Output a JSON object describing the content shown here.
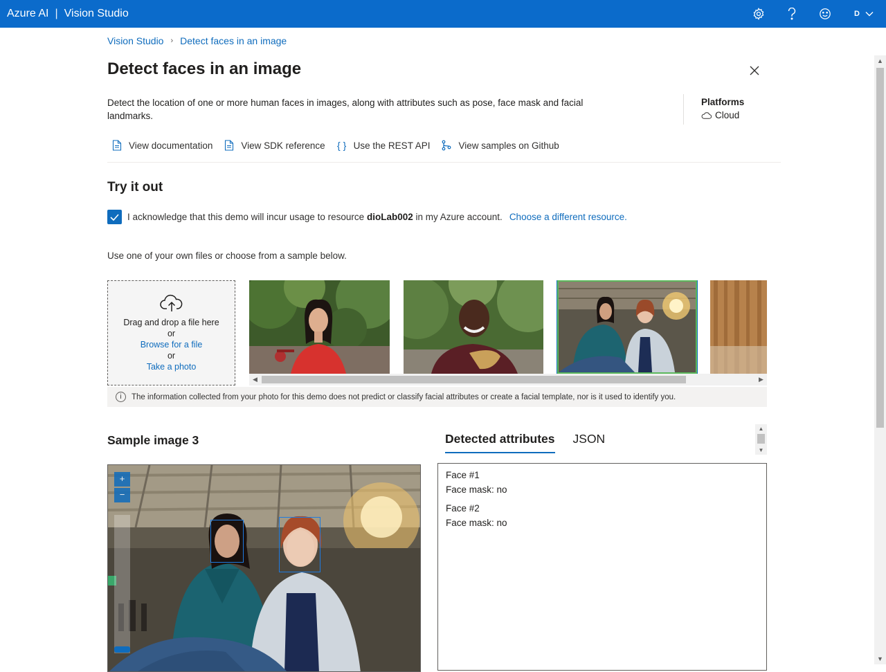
{
  "header": {
    "brand": "Azure AI",
    "separator": "|",
    "product": "Vision Studio",
    "avatar_initial": "D"
  },
  "breadcrumb": [
    "Vision Studio",
    "Detect faces in an image"
  ],
  "page": {
    "title": "Detect faces in an image",
    "description": "Detect the location of one or more human faces in images, along with attributes such as pose, face mask and facial landmarks.",
    "platforms_label": "Platforms",
    "platform": "Cloud"
  },
  "links": [
    {
      "label": "View documentation",
      "icon": "document-icon"
    },
    {
      "label": "View SDK reference",
      "icon": "document-icon"
    },
    {
      "label": "Use the REST API",
      "icon": "braces-icon"
    },
    {
      "label": "View samples on Github",
      "icon": "branch-icon"
    }
  ],
  "try": {
    "title": "Try it out",
    "ack_prefix": "I acknowledge that this demo will incur usage to resource",
    "ack_resource": "dioLab002",
    "ack_suffix": "in my Azure account.",
    "choose_link": "Choose a different resource.",
    "checked": true,
    "use_text": "Use one of your own files or choose from a sample below."
  },
  "upload": {
    "drag_text": "Drag and drop a file here",
    "or1": "or",
    "browse": "Browse for a file",
    "or2": "or",
    "photo": "Take a photo"
  },
  "samples": {
    "selected_index": 2
  },
  "info_text": "The information collected from your photo for this demo does not predict or classify facial attributes or create a facial template, nor is it used to identify you.",
  "result": {
    "sample_title": "Sample image 3",
    "tabs": [
      "Detected attributes",
      "JSON"
    ],
    "active_tab": 0,
    "faces": [
      {
        "label": "Face #1",
        "mask": "Face mask: no"
      },
      {
        "label": "Face #2",
        "mask": "Face mask: no"
      }
    ]
  },
  "colors": {
    "header_bg": "#0b6bcb",
    "accent": "#0f6cbd",
    "selected_border": "#5cb85c"
  }
}
